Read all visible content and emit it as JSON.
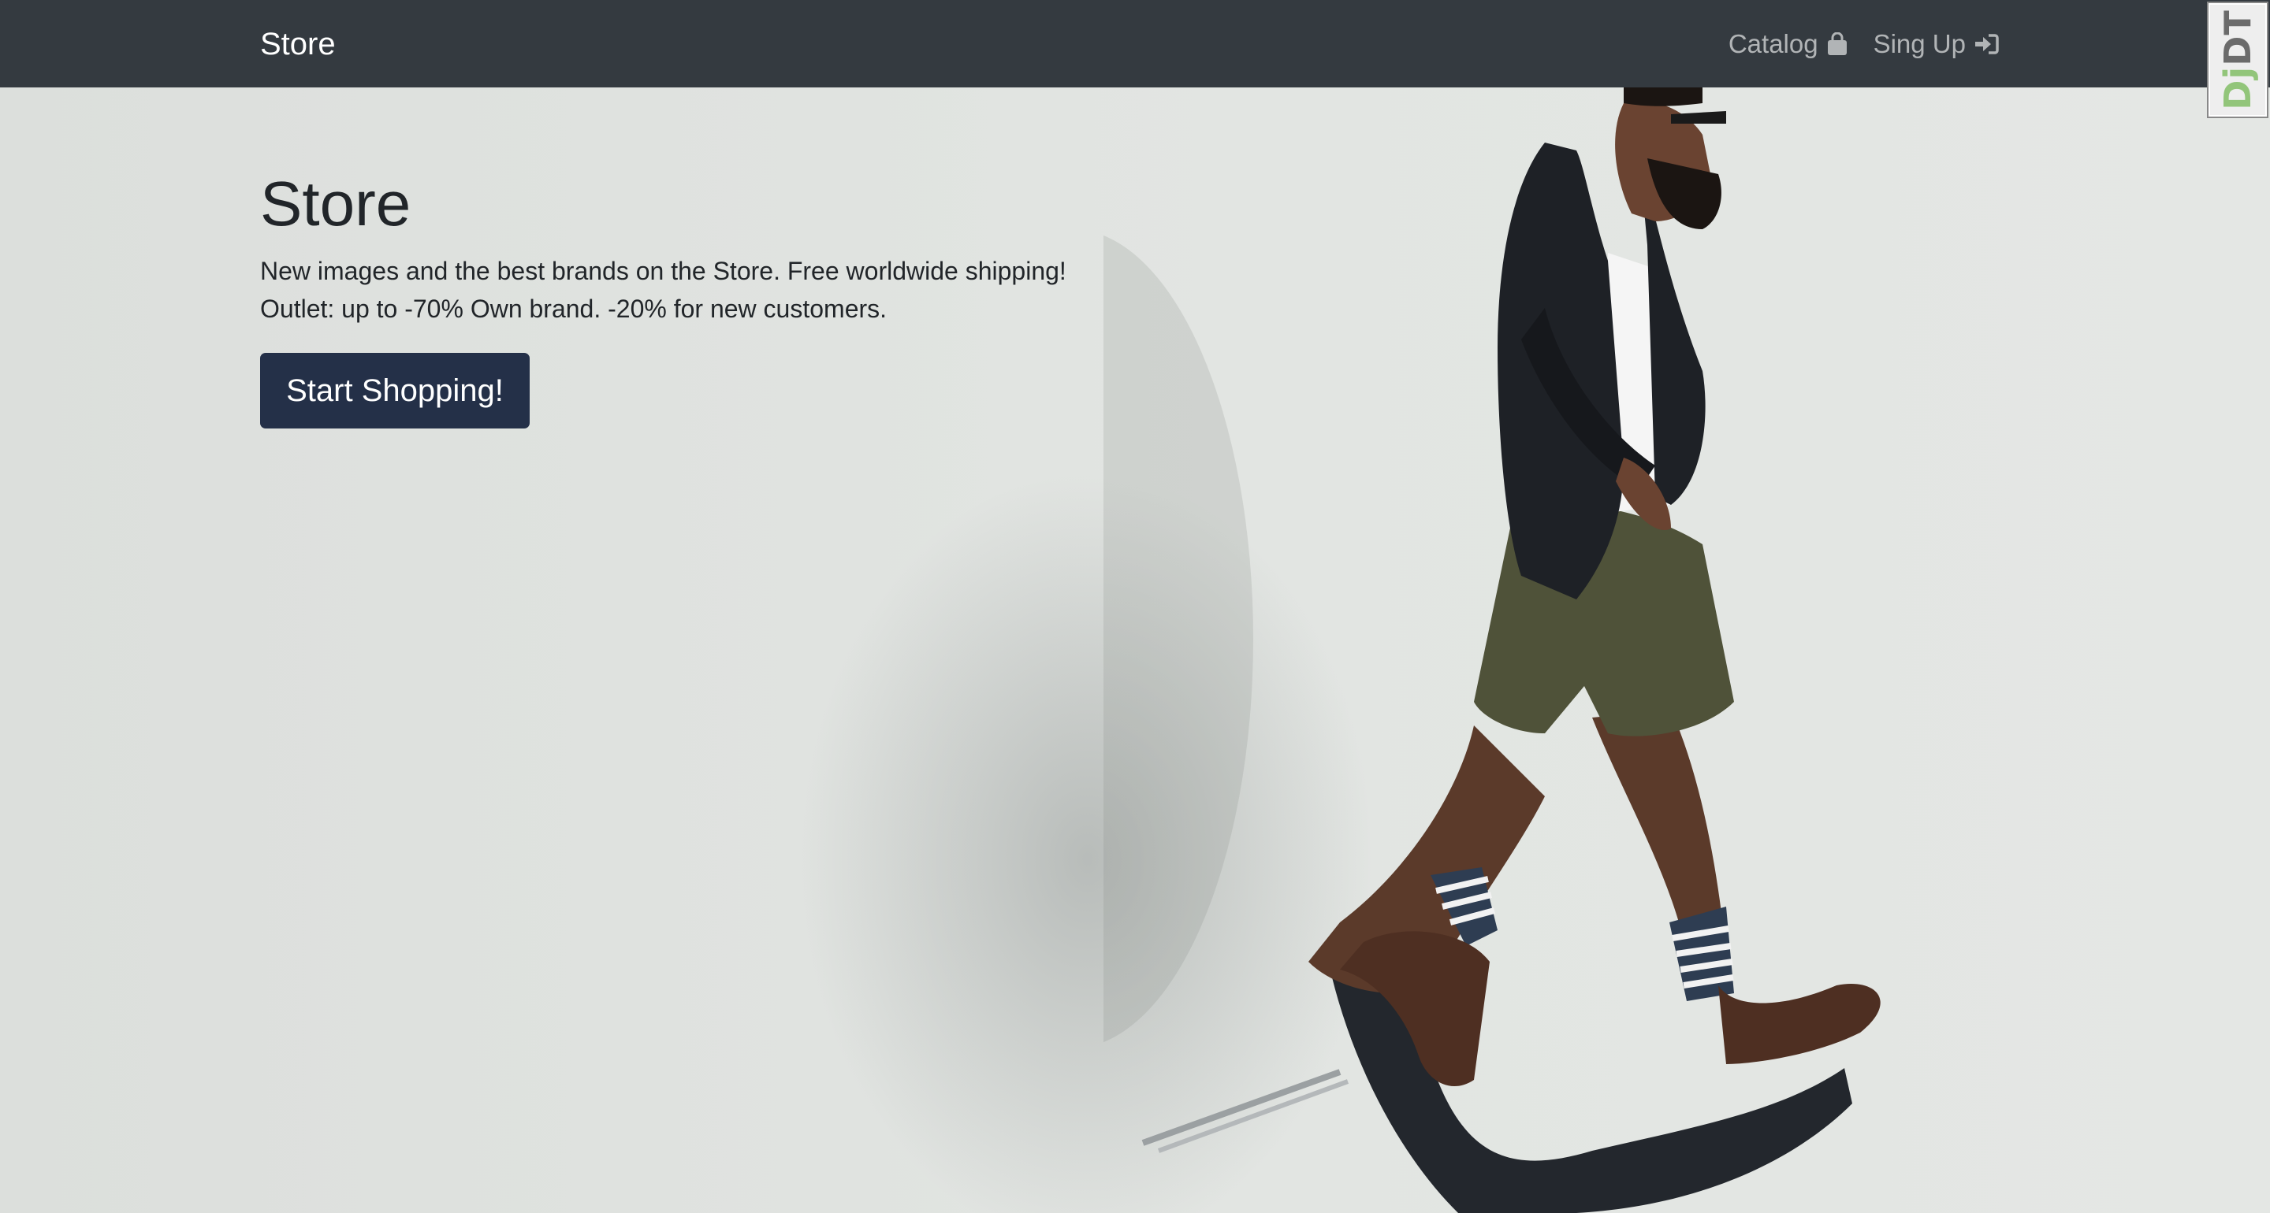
{
  "navbar": {
    "brand": "Store",
    "links": [
      {
        "label": "Catalog",
        "icon": "shopping-bag-icon"
      },
      {
        "label": "Sing Up",
        "icon": "sign-in-icon"
      }
    ]
  },
  "hero": {
    "title": "Store",
    "line1": "New images and the best brands on the Store. Free worldwide shipping!",
    "line2": "Outlet: up to -70% Own brand. -20% for new customers.",
    "cta_label": "Start Shopping!",
    "image_subject": "man in blazer, shorts and striped socks stepping off a chair"
  },
  "debug_toolbar": {
    "prefix": "Dj",
    "suffix": "DT"
  },
  "colors": {
    "navbar_bg": "#343a40",
    "cta_bg": "#243048",
    "hero_bg": "#dfe2e0",
    "text": "#212529"
  }
}
